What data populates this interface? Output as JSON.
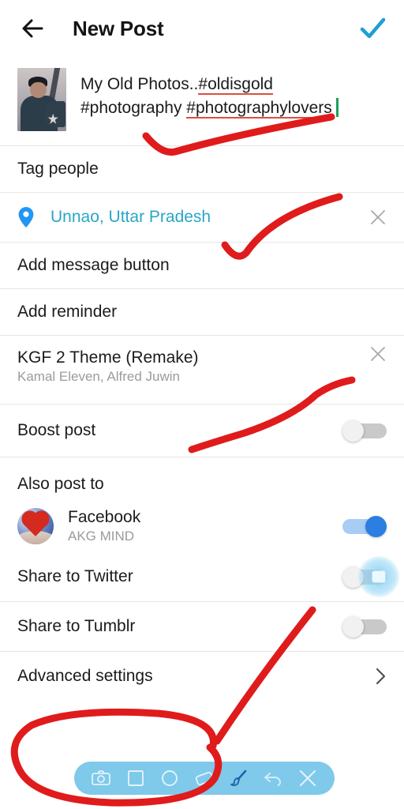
{
  "header": {
    "back_icon": "arrow-left-icon",
    "title": "New Post",
    "confirm_icon": "check-icon",
    "confirm_color": "#1d9fd4"
  },
  "caption": {
    "text_plain": "My Old Photos..",
    "hashtag1": "#oldisgold",
    "hashtag2": "#photography",
    "hashtag3": "#photographylovers",
    "thumbnail_name": "post-photo-thumbnail",
    "cursor_color": "#1b9f5a",
    "spellcheck_underline_color": "#d9503f"
  },
  "rows": {
    "tag_people": "Tag people",
    "location": {
      "name": "Unnao, Uttar Pradesh",
      "pin_icon": "location-pin-icon",
      "pin_color": "#2196F3",
      "text_color": "#2aa5c9",
      "remove_icon": "close-icon"
    },
    "add_message_button": "Add message button",
    "add_reminder": "Add reminder",
    "music": {
      "title": "KGF 2 Theme (Remake)",
      "artists": "Kamal Eleven, Alfred Juwin",
      "remove_icon": "close-icon"
    },
    "boost_post": {
      "label": "Boost post",
      "toggle_state": "off"
    }
  },
  "also_post_to": {
    "heading": "Also post to",
    "facebook": {
      "label": "Facebook",
      "account": "AKG MIND",
      "avatar_name": "facebook-account-avatar",
      "toggle_state": "on",
      "toggle_on_color": "#2a7fe0"
    },
    "twitter": {
      "label": "Share to Twitter",
      "toggle_state": "off"
    },
    "tumblr": {
      "label": "Share to Tumblr",
      "toggle_state": "off"
    }
  },
  "advanced_settings": {
    "label": "Advanced settings",
    "chevron_icon": "chevron-right-icon"
  },
  "draw_toolbar": {
    "background": "#7fc9eb",
    "tools": [
      {
        "name": "camera-icon",
        "label": "Camera"
      },
      {
        "name": "square-icon",
        "label": "Square"
      },
      {
        "name": "circle-icon",
        "label": "Circle"
      },
      {
        "name": "eraser-icon",
        "label": "Eraser"
      },
      {
        "name": "brush-icon",
        "label": "Brush"
      },
      {
        "name": "undo-icon",
        "label": "Undo"
      },
      {
        "name": "close-icon",
        "label": "Close"
      }
    ]
  },
  "annotations": {
    "color": "#e01b1b",
    "marks": [
      {
        "name": "caption-underline-mark",
        "shape": "check-stroke"
      },
      {
        "name": "location-check-mark",
        "shape": "check-stroke"
      },
      {
        "name": "music-underline-mark",
        "shape": "wave-stroke"
      },
      {
        "name": "advanced-settings-circle-mark",
        "shape": "ellipse"
      },
      {
        "name": "twitter-pointer-mark",
        "shape": "line"
      }
    ]
  }
}
